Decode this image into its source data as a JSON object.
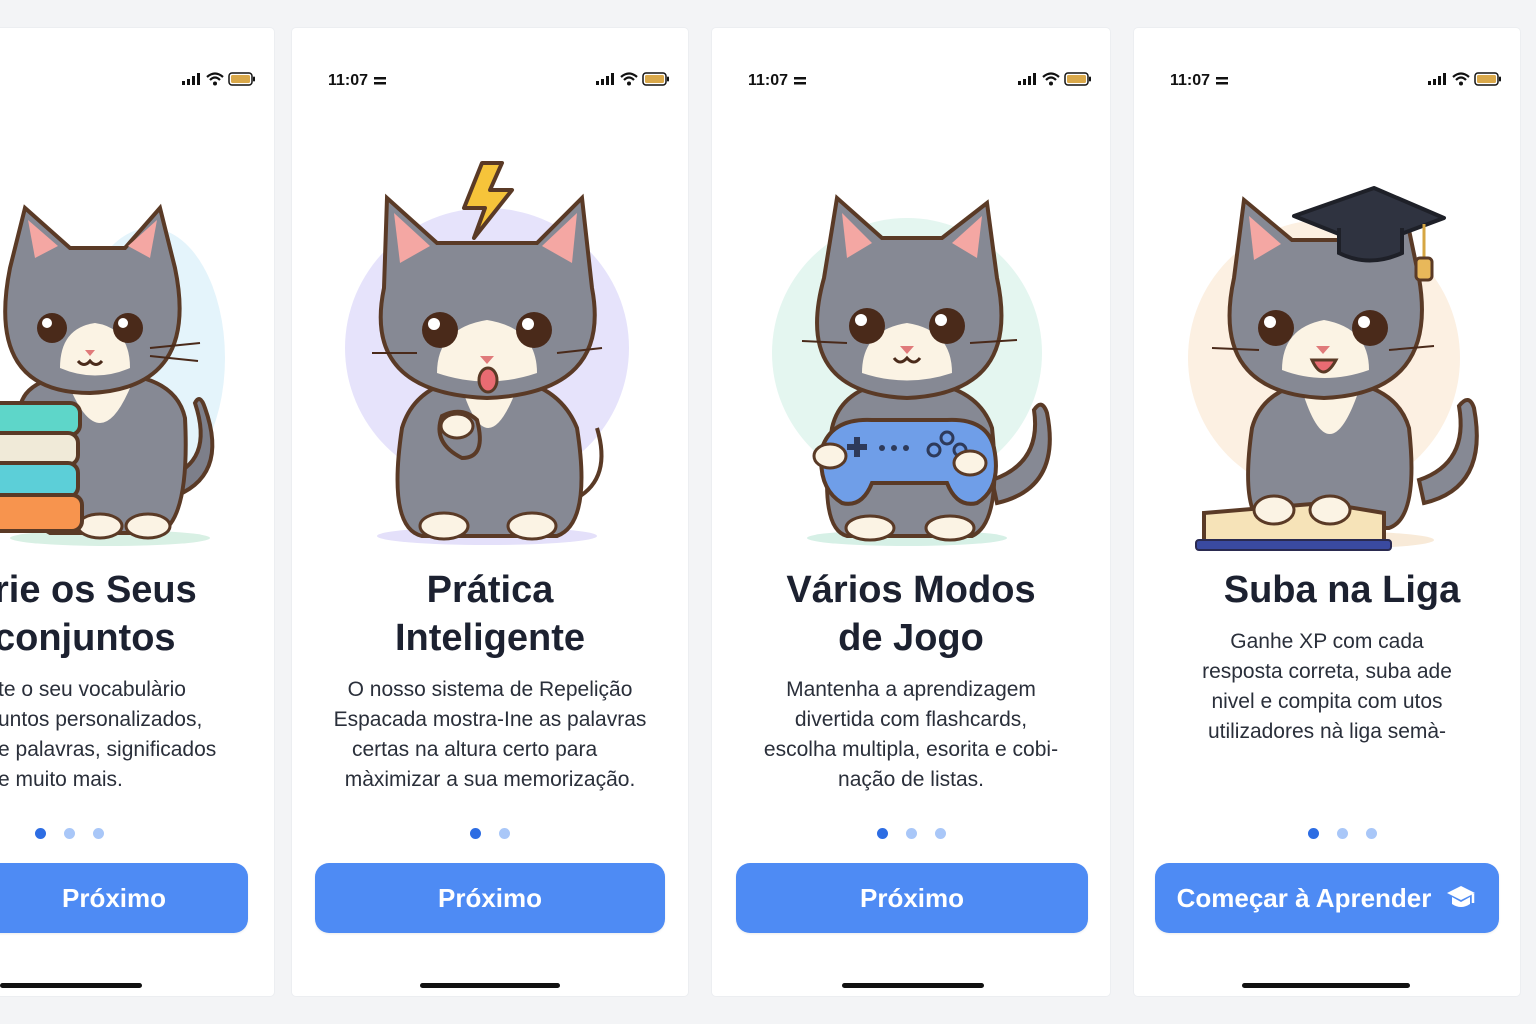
{
  "status": {
    "time": "11:07"
  },
  "accent": "#4e8bf4",
  "screens": [
    {
      "title_lines": [
        "rie os Seus",
        "conjuntos"
      ],
      "desc_lines": [
        "te o seu vocabulàrio",
        "untos personalizados,",
        "e palavras, significados",
        "e muito mais."
      ],
      "button_label": "Próximo",
      "dots": 3,
      "active_dot": 0,
      "illustration": "cat-with-books"
    },
    {
      "title_lines": [
        "Prática",
        "Inteligente"
      ],
      "desc_lines": [
        "O nosso sistema de Repelição",
        "Espacada mostra-Ine as palavras",
        "certas na altura certo para",
        "màximizar a sua memorização."
      ],
      "button_label": "Próximo",
      "dots": 2,
      "active_dot": 0,
      "illustration": "thinking-cat-lightning"
    },
    {
      "title_lines": [
        "Vários Modos",
        "de Jogo"
      ],
      "desc_lines": [
        "Mantenha a aprendizagem",
        "divertida com flashcards,",
        "escolha multipla, esorita e cobi-",
        "nação de listas."
      ],
      "button_label": "Próximo",
      "dots": 3,
      "active_dot": 0,
      "illustration": "cat-with-gamepad"
    },
    {
      "title_lines": [
        "Suba na Liga"
      ],
      "desc_lines": [
        "Ganhe XP com cada",
        "resposta correta, suba ade",
        "nivel e compita com utos",
        "utilizadores nà liga semà-"
      ],
      "button_label": "Começar à Aprender",
      "button_icon": "graduation-cap-icon",
      "dots": 3,
      "active_dot": 0,
      "illustration": "cat-graduation-cap-book"
    }
  ]
}
